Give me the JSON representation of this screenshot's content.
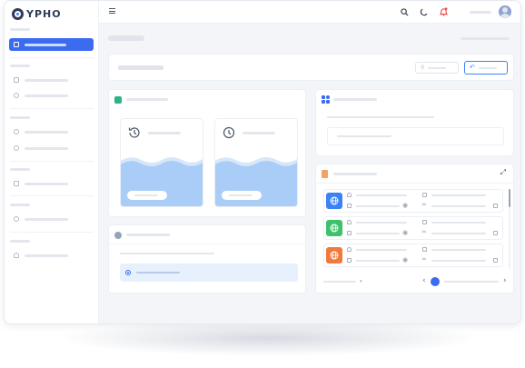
{
  "app": {
    "logo_text": "YPHO"
  },
  "topbar": {
    "menu_icon": "hamburger-icon",
    "icons": [
      "search-icon",
      "moon-icon",
      "bell-icon"
    ],
    "accent": "#3b82f6",
    "notification_color": "#ef4444"
  },
  "colors": {
    "primary": "#3b6cf0",
    "wave": "#a9cdf7",
    "wave_light": "#d7e7fb",
    "green": "#3cc26b",
    "orange": "#f07a3c",
    "orange_light": "#f4a261",
    "teal": "#2bb38a",
    "blue_row": "#3b82f6"
  },
  "sidebar": {
    "sections": 5,
    "items": [
      {
        "icon": "grid-icon",
        "active": true
      },
      {
        "icon": "cast-icon",
        "active": false
      },
      {
        "icon": "badge-icon",
        "active": false
      },
      {
        "icon": "target-icon",
        "active": false
      },
      {
        "icon": "plus-circle-icon",
        "active": false
      },
      {
        "icon": "window-icon",
        "active": false
      },
      {
        "icon": "chart-pie-icon",
        "active": false
      },
      {
        "icon": "user-icon",
        "active": false
      }
    ]
  },
  "actions": {
    "filter_icon": "filter-icon",
    "reset_icon": "undo-icon"
  },
  "cards": {
    "left_top": {
      "icon": "gear-icon",
      "tiles": [
        {
          "icon": "history-icon"
        },
        {
          "icon": "clock-icon"
        }
      ]
    },
    "left_bottom": {
      "icon": "settings-icon",
      "item_icon": "radio-icon"
    },
    "right_top": {
      "icon": "apps-icon"
    },
    "right_bottom": {
      "icon": "document-icon",
      "expand_icon": "expand-icon",
      "rows": [
        {
          "icon": "globe-icon",
          "color": "#3b82f6"
        },
        {
          "icon": "globe-icon",
          "color": "#3cc26b"
        },
        {
          "icon": "globe-icon",
          "color": "#f07a3c"
        }
      ],
      "pager": {
        "prev": "chevron-left-icon",
        "next": "chevron-right-icon"
      }
    }
  }
}
